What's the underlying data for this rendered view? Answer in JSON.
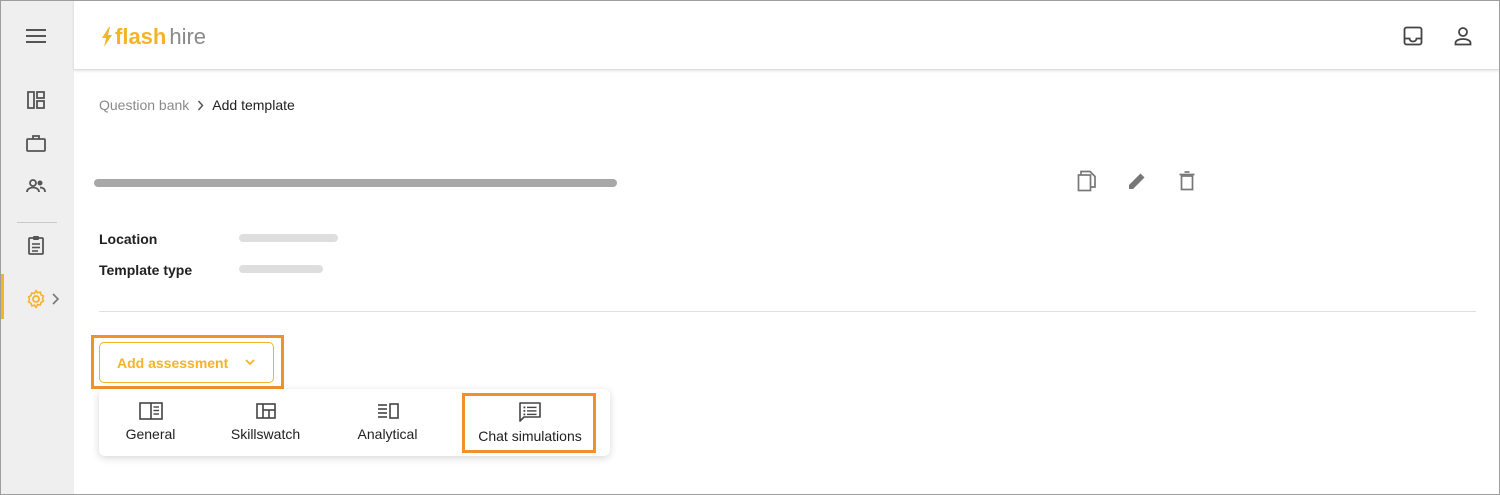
{
  "brand": {
    "name_part1": "flash",
    "name_part2": "hire",
    "accent_color": "#f5b32a",
    "highlight_color": "#f0922c"
  },
  "topbar": {
    "icons": [
      "inbox-icon",
      "account-icon"
    ]
  },
  "sidebar": {
    "menu_icon": "hamburger-menu-icon",
    "items": [
      {
        "icon": "dashboard-icon"
      },
      {
        "icon": "briefcase-icon"
      },
      {
        "icon": "people-icon"
      },
      {
        "icon": "clipboard-icon"
      },
      {
        "icon": "settings-gear-icon",
        "active": true
      }
    ]
  },
  "breadcrumb": {
    "parent": "Question bank",
    "current": "Add template"
  },
  "template": {
    "actions": [
      "copy-icon",
      "edit-pencil-icon",
      "delete-trash-icon"
    ],
    "fields": [
      {
        "label": "Location"
      },
      {
        "label": "Template type"
      }
    ]
  },
  "add_assessment": {
    "label": "Add assessment",
    "menu": [
      {
        "label": "General",
        "icon": "general-icon"
      },
      {
        "label": "Skillswatch",
        "icon": "skillswatch-icon"
      },
      {
        "label": "Analytical",
        "icon": "analytical-icon"
      },
      {
        "label": "Chat simulations",
        "icon": "chat-icon"
      }
    ]
  }
}
